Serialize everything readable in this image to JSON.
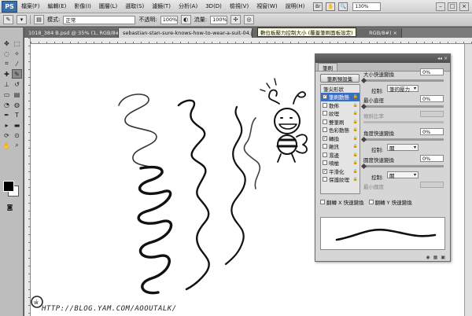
{
  "app": {
    "logo": "PS"
  },
  "menu": [
    "檔案(F)",
    "編輯(E)",
    "影像(I)",
    "圖層(L)",
    "選取(S)",
    "濾鏡(T)",
    "分析(A)",
    "3D(D)",
    "檢視(V)",
    "視窗(W)",
    "說明(H)"
  ],
  "menu_zoom": "130%",
  "options": {
    "mode_label": "模式:",
    "mode_value": "正常",
    "opacity_label": "不透明:",
    "opacity_value": "100%",
    "flow_label": "流量:",
    "flow_value": "100%"
  },
  "tabs": [
    "1018_384 B.psd @ 35% (1, RGB/8#) ×",
    "sebastian-stan-sure-knows-how-to-wear-a-suit-04.jpg ×",
    "RGB/8#) ×"
  ],
  "tooltip": "數位板壓力控制大小 (覆蓋筆刷面板設定)",
  "brush_panel": {
    "tab": "筆刷",
    "preset_button": "筆刷預設集",
    "list_header": "筆尖形狀",
    "items": [
      {
        "label": "筆刷動態",
        "checked": true,
        "selected": true
      },
      {
        "label": "散佈",
        "checked": false
      },
      {
        "label": "紋理",
        "checked": false
      },
      {
        "label": "雙筆刷",
        "checked": false
      },
      {
        "label": "色彩動態",
        "checked": false
      },
      {
        "label": "轉換",
        "checked": true
      },
      {
        "label": "雜訊",
        "checked": false
      },
      {
        "label": "濕邊",
        "checked": false
      },
      {
        "label": "噴槍",
        "checked": false
      },
      {
        "label": "平滑化",
        "checked": true
      },
      {
        "label": "保護紋理",
        "checked": false
      }
    ],
    "size_jitter_label": "大小快速變換",
    "size_jitter_value": "0%",
    "control_label": "控制:",
    "control_value": "筆的壓力",
    "min_diameter_label": "最小直徑",
    "min_diameter_value": "0%",
    "tilt_scale_label": "傾斜比率",
    "angle_jitter_label": "角度快速變換",
    "angle_jitter_value": "0%",
    "angle_control_value": "關",
    "roundness_jitter_label": "圓度快速變換",
    "roundness_jitter_value": "0%",
    "roundness_control_value": "關",
    "min_roundness_label": "最小圓度",
    "flip_x_label": "翻轉 X 快速變換",
    "flip_y_label": "翻轉 Y 快速變換"
  },
  "watermark": "HTTP://BLOG.YAM.COM/AOOUTALK/"
}
